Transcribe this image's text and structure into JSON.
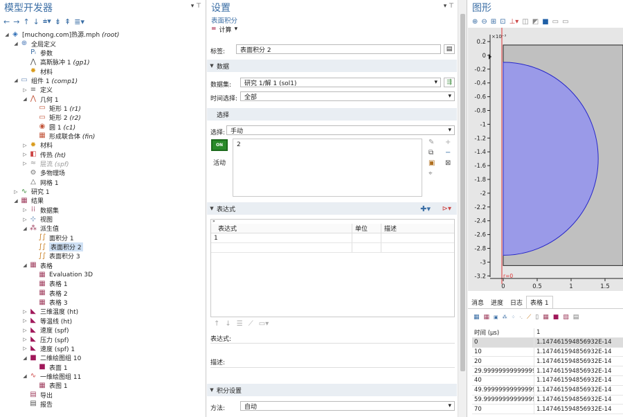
{
  "model_builder": {
    "title": "模型开发器",
    "tree": [
      {
        "label": "[muchong.com]热源.mph",
        "italic": "(root)",
        "depth": 0,
        "arrow": "◢",
        "icon": "◈",
        "color": "#2b6cb5"
      },
      {
        "label": "全局定义",
        "depth": 1,
        "arrow": "◢",
        "icon": "⊕",
        "color": "#4c7ab8"
      },
      {
        "label": "参数",
        "depth": 2,
        "arrow": "",
        "icon": "Pᵢ",
        "color": "#3a6ea5"
      },
      {
        "label": "高斯脉冲 1",
        "italic": "(gp1)",
        "depth": 2,
        "arrow": "",
        "icon": "⋀",
        "color": "#555"
      },
      {
        "label": "材料",
        "depth": 2,
        "arrow": "",
        "icon": "✹",
        "color": "#d99b1b"
      },
      {
        "label": "组件 1",
        "italic": "(comp1)",
        "depth": 1,
        "arrow": "◢",
        "icon": "▭",
        "color": "#6d8cb8"
      },
      {
        "label": "定义",
        "depth": 2,
        "arrow": "▷",
        "icon": "≡",
        "color": "#666"
      },
      {
        "label": "几何 1",
        "depth": 2,
        "arrow": "◢",
        "icon": "⋀",
        "color": "#c2553a"
      },
      {
        "label": "矩形 1",
        "italic": "(r1)",
        "depth": 3,
        "arrow": "",
        "icon": "▭",
        "color": "#c2553a"
      },
      {
        "label": "矩形 2",
        "italic": "(r2)",
        "depth": 3,
        "arrow": "",
        "icon": "▭",
        "color": "#c2553a"
      },
      {
        "label": "圆 1",
        "italic": "(c1)",
        "depth": 3,
        "arrow": "",
        "icon": "◉",
        "color": "#c2553a"
      },
      {
        "label": "形成联合体",
        "italic": "(fin)",
        "depth": 3,
        "arrow": "",
        "icon": "▦",
        "color": "#c2553a"
      },
      {
        "label": "材料",
        "depth": 2,
        "arrow": "▷",
        "icon": "✹",
        "color": "#d99b1b"
      },
      {
        "label": "传热",
        "italic": "(ht)",
        "depth": 2,
        "arrow": "▷",
        "icon": "◧",
        "color": "#c44"
      },
      {
        "label": "层流",
        "italic": "(spf)",
        "depth": 2,
        "arrow": "▷",
        "icon": "≈",
        "color": "#999",
        "dim": true
      },
      {
        "label": "多物理场",
        "depth": 2,
        "arrow": "",
        "icon": "⚙",
        "color": "#777"
      },
      {
        "label": "网格 1",
        "depth": 2,
        "arrow": "",
        "icon": "△",
        "color": "#555"
      },
      {
        "label": "研究 1",
        "depth": 1,
        "arrow": "▷",
        "icon": "∿",
        "color": "#3a8a3a"
      },
      {
        "label": "结果",
        "depth": 1,
        "arrow": "◢",
        "icon": "▦",
        "color": "#a04060"
      },
      {
        "label": "数据集",
        "depth": 2,
        "arrow": "▷",
        "icon": "⁞⁞",
        "color": "#a04060"
      },
      {
        "label": "视图",
        "depth": 2,
        "arrow": "▷",
        "icon": "⊹",
        "color": "#3a6ea5"
      },
      {
        "label": "派生值",
        "depth": 2,
        "arrow": "◢",
        "icon": "⁂",
        "color": "#a04060"
      },
      {
        "label": "面积分 1",
        "depth": 3,
        "arrow": "",
        "icon": "∫∫",
        "color": "#c77a1a"
      },
      {
        "label": "表面积分 2",
        "depth": 3,
        "arrow": "",
        "icon": "∫∫",
        "color": "#c77a1a",
        "selected": true
      },
      {
        "label": "表面积分 3",
        "depth": 3,
        "arrow": "",
        "icon": "∫∫",
        "color": "#c77a1a"
      },
      {
        "label": "表格",
        "depth": 2,
        "arrow": "◢",
        "icon": "▦",
        "color": "#a04060"
      },
      {
        "label": "Evaluation 3D",
        "depth": 3,
        "arrow": "",
        "icon": "▦",
        "color": "#a04060"
      },
      {
        "label": "表格 1",
        "depth": 3,
        "arrow": "",
        "icon": "▦",
        "color": "#a04060"
      },
      {
        "label": "表格 2",
        "depth": 3,
        "arrow": "",
        "icon": "▦",
        "color": "#a04060"
      },
      {
        "label": "表格 3",
        "depth": 3,
        "arrow": "",
        "icon": "▦",
        "color": "#a04060"
      },
      {
        "label": "三维温度 (ht)",
        "depth": 2,
        "arrow": "▷",
        "icon": "◣",
        "color": "#a0185a"
      },
      {
        "label": "等温线 (ht)",
        "depth": 2,
        "arrow": "▷",
        "icon": "◣",
        "color": "#a0185a"
      },
      {
        "label": "速度 (spf)",
        "depth": 2,
        "arrow": "▷",
        "icon": "◣",
        "color": "#a0185a"
      },
      {
        "label": "压力 (spf)",
        "depth": 2,
        "arrow": "▷",
        "icon": "◣",
        "color": "#a0185a"
      },
      {
        "label": "速度 (spf) 1",
        "depth": 2,
        "arrow": "▷",
        "icon": "◣",
        "color": "#a0185a"
      },
      {
        "label": "二维绘图组 10",
        "depth": 2,
        "arrow": "◢",
        "icon": "■",
        "color": "#a0185a"
      },
      {
        "label": "表面 1",
        "depth": 3,
        "arrow": "",
        "icon": "■",
        "color": "#a0185a"
      },
      {
        "label": "一维绘图组 11",
        "depth": 2,
        "arrow": "◢",
        "icon": "∿",
        "color": "#c44"
      },
      {
        "label": "表图 1",
        "depth": 3,
        "arrow": "",
        "icon": "▦",
        "color": "#a04060"
      },
      {
        "label": "导出",
        "depth": 2,
        "arrow": "",
        "icon": "▤",
        "color": "#a04060"
      },
      {
        "label": "报告",
        "depth": 2,
        "arrow": "",
        "icon": "▤",
        "color": "#555"
      }
    ]
  },
  "settings": {
    "title": "设置",
    "subtitle": "表面积分",
    "compute": "计算",
    "label_caption": "标签:",
    "label_value": "表面积分 2",
    "section_data": "数据",
    "dataset_caption": "数据集:",
    "dataset_value": "研究 1/解 1 (sol1)",
    "time_caption": "时间选择:",
    "time_value": "全部",
    "section_selection": "选择",
    "selection_caption": "选择:",
    "selection_value": "手动",
    "selection_item": "2",
    "active_label": "活动",
    "active_icon_text": "ON",
    "section_expression": "表达式",
    "expr_headers": [
      "表达式",
      "单位",
      "描述"
    ],
    "expr_row": [
      "1",
      "",
      ""
    ],
    "expression_caption": "表达式:",
    "description_caption": "描述:",
    "section_integration": "积分设置",
    "method_caption": "方法:",
    "method_value": "自动"
  },
  "graphics": {
    "title": "图形",
    "y_ticks": [
      "0.2",
      "0",
      "-0.2",
      "-0.4",
      "-0.6",
      "-0.8",
      "-1",
      "-1.2",
      "-1.4",
      "-1.6",
      "-1.8",
      "-2",
      "-2.2",
      "-2.4",
      "-2.6",
      "-2.8",
      "-3",
      "-3.2"
    ],
    "x_ticks": [
      "0",
      "0.5",
      "1",
      "1.5"
    ],
    "exponent": "×10⁻³",
    "axis_annotation": "r=0"
  },
  "bottom": {
    "tabs": [
      "消息",
      "进度",
      "日志",
      "表格 1"
    ],
    "active_tab": 3,
    "col_headers": [
      "时间 (μs)",
      "1"
    ],
    "rows": [
      [
        "0",
        "1.147461594856932E-14"
      ],
      [
        "10",
        "1.147461594856932E-14"
      ],
      [
        "20",
        "1.147461594856932E-14"
      ],
      [
        "29.999999999999996",
        "1.147461594856932E-14"
      ],
      [
        "40",
        "1.147461594856932E-14"
      ],
      [
        "49.999999999999999",
        "1.147461594856932E-14"
      ],
      [
        "59.999999999999999",
        "1.147461594856932E-14"
      ],
      [
        "70",
        "1.147461594856932E-14"
      ]
    ]
  }
}
